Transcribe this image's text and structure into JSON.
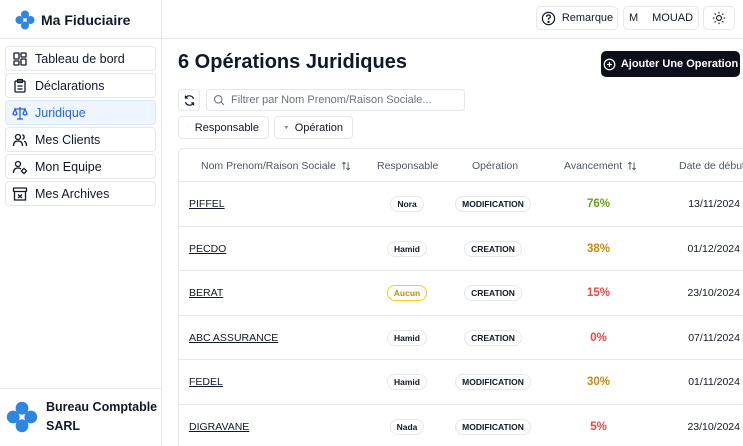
{
  "app": {
    "brand": "Ma Fiduciaire",
    "company_line1": "Bureau Comptable",
    "company_line2": "SARL"
  },
  "sidebar": {
    "items": [
      {
        "label": "Tableau de bord",
        "icon": "dashboard-icon",
        "active": false
      },
      {
        "label": "Déclarations",
        "icon": "clipboard-icon",
        "active": false
      },
      {
        "label": "Juridique",
        "icon": "scale-icon",
        "active": true
      },
      {
        "label": "Mes Clients",
        "icon": "users-icon",
        "active": false
      },
      {
        "label": "Mon Equipe",
        "icon": "user-gear-icon",
        "active": false
      },
      {
        "label": "Mes Archives",
        "icon": "archive-icon",
        "active": false
      }
    ]
  },
  "header": {
    "remarque_label": "Remarque",
    "user_initial": "M",
    "user_name": "MOUAD"
  },
  "main": {
    "title": "6 Opérations Juridiques",
    "add_button_label": "Ajouter Une Operation",
    "search_placeholder": "Filtrer par Nom Prenom/Raison Sociale...",
    "filters": [
      "Responsable",
      "Opération"
    ]
  },
  "table": {
    "columns": [
      "Nom Prenom/Raison Sociale",
      "Responsable",
      "Opération",
      "Avancement",
      "Date de début"
    ],
    "rows": [
      {
        "name": "PIFFEL",
        "responsable": "Nora",
        "operation": "MODIFICATION",
        "avancement": "76%",
        "date": "13/11/2024",
        "av_color": "#65a30d"
      },
      {
        "name": "PECDO",
        "responsable": "Hamid",
        "operation": "CREATION",
        "avancement": "38%",
        "date": "01/12/2024",
        "av_color": "#ca8a04"
      },
      {
        "name": "BERAT",
        "responsable": "Aucun",
        "operation": "CREATION",
        "avancement": "15%",
        "date": "23/10/2024",
        "av_color": "#ef4444"
      },
      {
        "name": "ABC ASSURANCE",
        "responsable": "Hamid",
        "operation": "CREATION",
        "avancement": "0%",
        "date": "07/11/2024",
        "av_color": "#ef4444"
      },
      {
        "name": "FEDEL",
        "responsable": "Hamid",
        "operation": "MODIFICATION",
        "avancement": "30%",
        "date": "01/11/2024",
        "av_color": "#ca8a04"
      },
      {
        "name": "DIGRAVANE",
        "responsable": "Nada",
        "operation": "MODIFICATION",
        "avancement": "5%",
        "date": "23/10/2024",
        "av_color": "#ef4444"
      }
    ]
  },
  "colors": {
    "accent": "#2563eb",
    "primary_button": "#0b0f1a",
    "logo_blue": "#2e86de"
  }
}
